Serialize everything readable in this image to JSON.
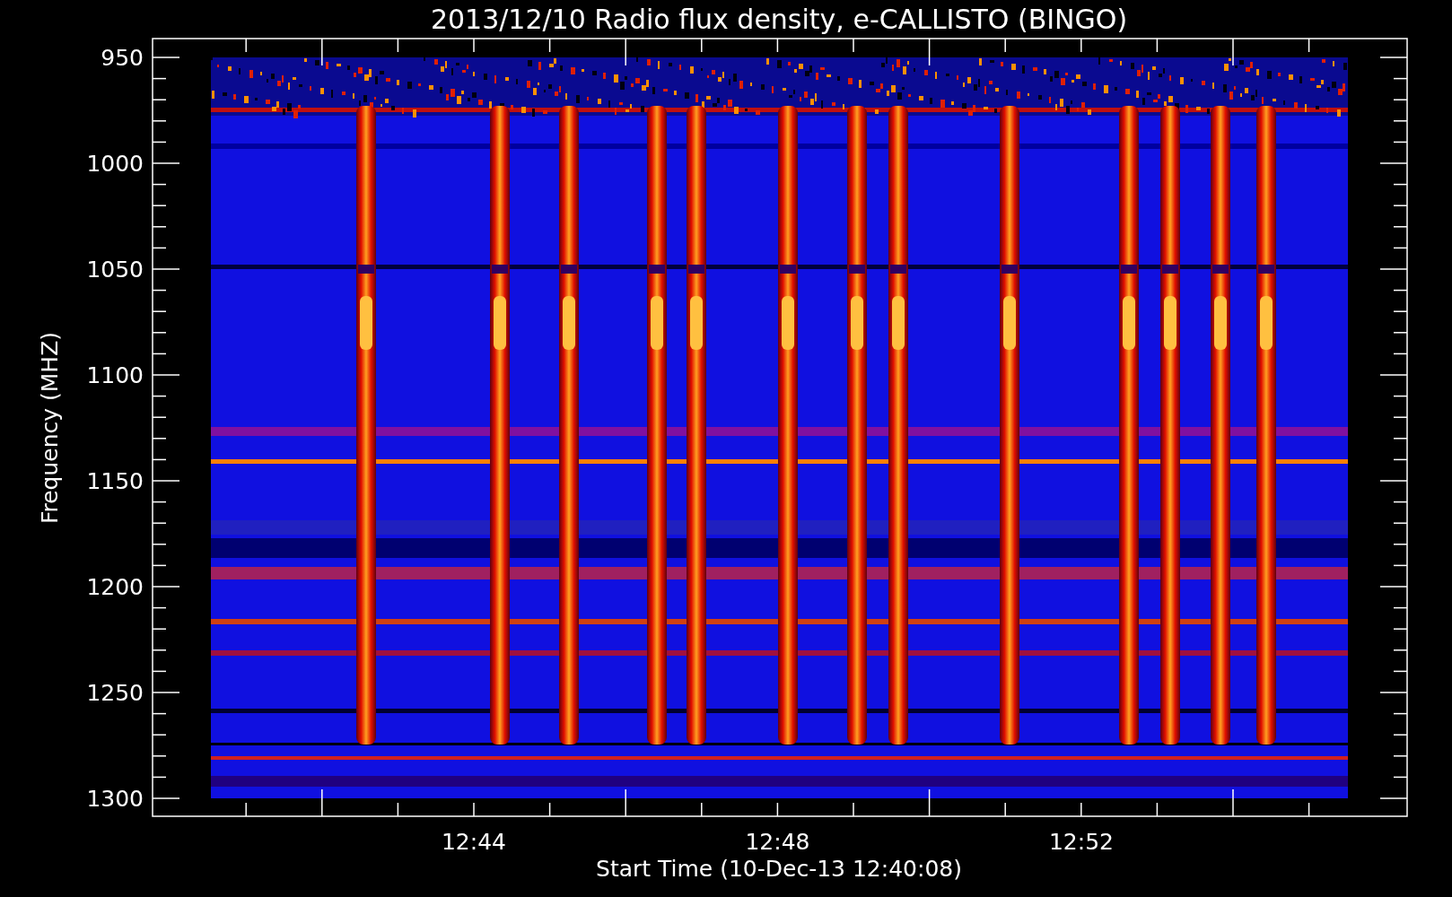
{
  "title": "2013/12/10  Radio flux density, e-CALLISTO (BINGO)",
  "y_axis": {
    "label": "Frequency (MHZ)",
    "ticks": [
      "950",
      "1000",
      "1050",
      "1100",
      "1150",
      "1200",
      "1250",
      "1300"
    ]
  },
  "x_axis": {
    "label": "Start Time (10-Dec-13 12:40:08)",
    "ticks": [
      "12:44",
      "12:48",
      "12:52"
    ]
  }
}
